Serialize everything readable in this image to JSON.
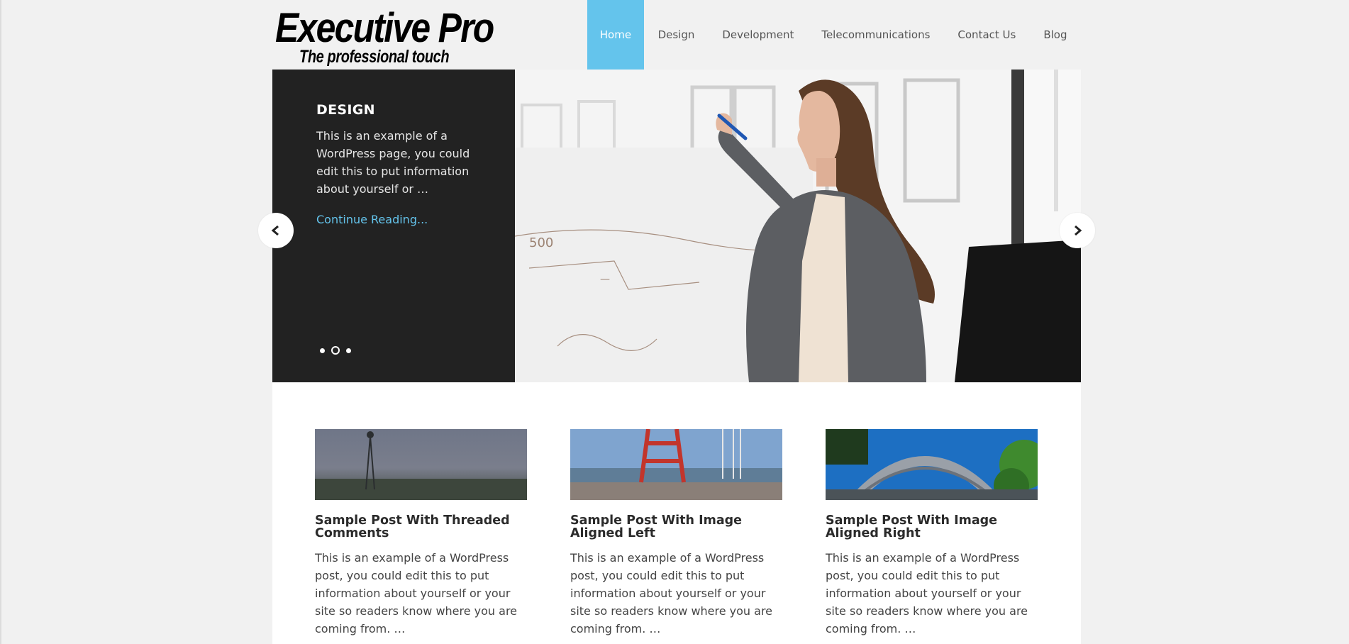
{
  "site": {
    "title": "Executive Pro",
    "tagline": "The professional touch"
  },
  "nav": {
    "items": [
      {
        "label": "Home",
        "active": true
      },
      {
        "label": "Design",
        "active": false
      },
      {
        "label": "Development",
        "active": false
      },
      {
        "label": "Telecommunications",
        "active": false
      },
      {
        "label": "Contact Us",
        "active": false
      },
      {
        "label": "Blog",
        "active": false
      }
    ]
  },
  "slider": {
    "title": "DESIGN",
    "excerpt": "This is an example of a WordPress page, you could edit this to put information about yourself or …",
    "link": "Continue Reading...",
    "dots_total": 3,
    "active_dot": 2
  },
  "posts": [
    {
      "title": "Sample Post With Threaded Comments",
      "excerpt": "This is an example of a WordPress post, you could edit this to put information about yourself or your site so readers know where you are coming from. …"
    },
    {
      "title": "Sample Post With Image Aligned Left",
      "excerpt": "This is an example of a WordPress post, you could edit this to put information about yourself or your site so readers know where you are coming from. …"
    },
    {
      "title": "Sample Post With Image Aligned Right",
      "excerpt": "This is an example of a WordPress post, you could edit this to put information about yourself or your site so readers know where you are coming from. …"
    }
  ],
  "colors": {
    "accent": "#64c4ec",
    "slider_panel": "#222222",
    "page_background": "#f1f1f1"
  }
}
